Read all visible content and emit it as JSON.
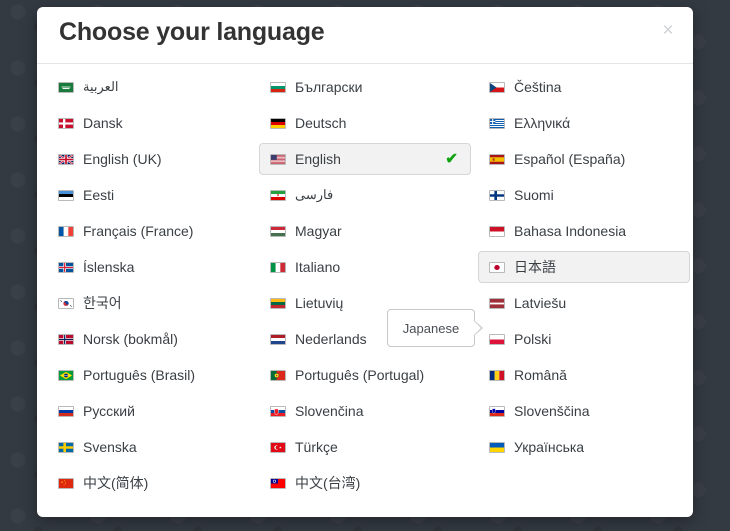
{
  "backdrop": {
    "color": "#343a42"
  },
  "modal": {
    "title": "Choose your language",
    "close_label": "×",
    "check_glyph": "✔",
    "accent_check_color": "#10a310",
    "selected_bg": "#f2f2f2"
  },
  "tooltip": {
    "text": "Japanese",
    "target": "ja"
  },
  "columns": [
    {
      "items": [
        {
          "code": "ar",
          "label": "العربية",
          "flag": "flag-sa",
          "rtl": true,
          "state": "normal"
        },
        {
          "code": "da",
          "label": "Dansk",
          "flag": "flag-dk",
          "rtl": false,
          "state": "normal"
        },
        {
          "code": "en-gb",
          "label": "English (UK)",
          "flag": "flag-gb",
          "rtl": false,
          "state": "normal"
        },
        {
          "code": "et",
          "label": "Eesti",
          "flag": "flag-ee",
          "rtl": false,
          "state": "normal"
        },
        {
          "code": "fr",
          "label": "Français (France)",
          "flag": "flag-fr",
          "rtl": false,
          "state": "normal"
        },
        {
          "code": "is",
          "label": "Íslenska",
          "flag": "flag-is",
          "rtl": false,
          "state": "normal"
        },
        {
          "code": "ko",
          "label": "한국어",
          "flag": "flag-kr",
          "rtl": false,
          "state": "normal"
        },
        {
          "code": "nb",
          "label": "Norsk (bokmål)",
          "flag": "flag-no",
          "rtl": false,
          "state": "normal"
        },
        {
          "code": "pt-br",
          "label": "Português (Brasil)",
          "flag": "flag-br",
          "rtl": false,
          "state": "normal"
        },
        {
          "code": "ru",
          "label": "Русский",
          "flag": "flag-ru",
          "rtl": false,
          "state": "normal"
        },
        {
          "code": "sv",
          "label": "Svenska",
          "flag": "flag-se",
          "rtl": false,
          "state": "normal"
        },
        {
          "code": "zh-cn",
          "label": "中文(简体)",
          "flag": "flag-cn",
          "rtl": false,
          "state": "normal"
        }
      ]
    },
    {
      "items": [
        {
          "code": "bg",
          "label": "Български",
          "flag": "flag-bg",
          "rtl": false,
          "state": "normal"
        },
        {
          "code": "de",
          "label": "Deutsch",
          "flag": "flag-de",
          "rtl": false,
          "state": "normal"
        },
        {
          "code": "en",
          "label": "English",
          "flag": "flag-us",
          "rtl": false,
          "state": "selected"
        },
        {
          "code": "fa",
          "label": "فارسی",
          "flag": "flag-ir",
          "rtl": true,
          "state": "normal"
        },
        {
          "code": "hu",
          "label": "Magyar",
          "flag": "flag-hu",
          "rtl": false,
          "state": "normal"
        },
        {
          "code": "it",
          "label": "Italiano",
          "flag": "flag-it",
          "rtl": false,
          "state": "normal"
        },
        {
          "code": "lt",
          "label": "Lietuvių",
          "flag": "flag-lt",
          "rtl": false,
          "state": "normal"
        },
        {
          "code": "nl",
          "label": "Nederlands",
          "flag": "flag-nl",
          "rtl": false,
          "state": "normal"
        },
        {
          "code": "pt",
          "label": "Português (Portugal)",
          "flag": "flag-pt",
          "rtl": false,
          "state": "normal"
        },
        {
          "code": "sk",
          "label": "Slovenčina",
          "flag": "flag-sk",
          "rtl": false,
          "state": "normal"
        },
        {
          "code": "tr",
          "label": "Türkçe",
          "flag": "flag-tr",
          "rtl": false,
          "state": "normal"
        },
        {
          "code": "zh-tw",
          "label": "中文(台湾)",
          "flag": "flag-tw",
          "rtl": false,
          "state": "normal"
        }
      ]
    },
    {
      "items": [
        {
          "code": "cs",
          "label": "Čeština",
          "flag": "flag-cz",
          "rtl": false,
          "state": "normal"
        },
        {
          "code": "el",
          "label": "Ελληνικά",
          "flag": "flag-gr",
          "rtl": false,
          "state": "normal"
        },
        {
          "code": "es",
          "label": "Español (España)",
          "flag": "flag-es",
          "rtl": false,
          "state": "normal"
        },
        {
          "code": "fi",
          "label": "Suomi",
          "flag": "flag-fi",
          "rtl": false,
          "state": "normal"
        },
        {
          "code": "id",
          "label": "Bahasa Indonesia",
          "flag": "flag-id",
          "rtl": false,
          "state": "normal"
        },
        {
          "code": "ja",
          "label": "日本語",
          "flag": "flag-jp",
          "rtl": false,
          "state": "hover"
        },
        {
          "code": "lv",
          "label": "Latviešu",
          "flag": "flag-lv",
          "rtl": false,
          "state": "normal"
        },
        {
          "code": "pl",
          "label": "Polski",
          "flag": "flag-pl",
          "rtl": false,
          "state": "normal"
        },
        {
          "code": "ro",
          "label": "Română",
          "flag": "flag-ro",
          "rtl": false,
          "state": "normal"
        },
        {
          "code": "sl",
          "label": "Slovenščina",
          "flag": "flag-si",
          "rtl": false,
          "state": "normal"
        },
        {
          "code": "uk",
          "label": "Українська",
          "flag": "flag-ua",
          "rtl": false,
          "state": "normal"
        }
      ]
    }
  ]
}
